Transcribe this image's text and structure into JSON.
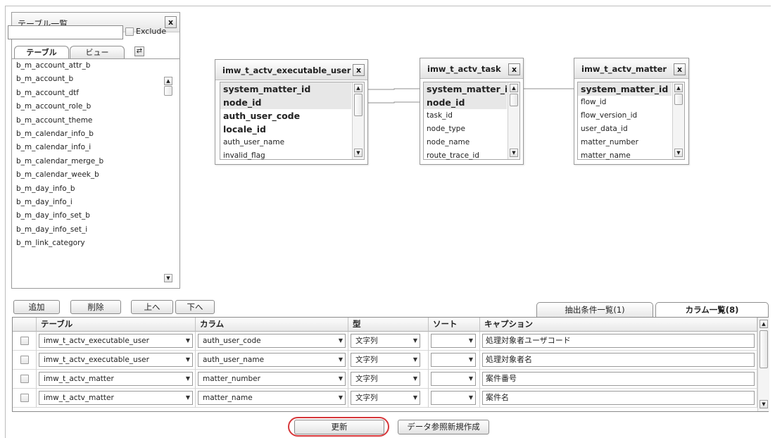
{
  "table_panel": {
    "title": "テーブル一覧",
    "close_glyph": "x",
    "search_placeholder": "",
    "exclude_label": "Exclude",
    "tabs": [
      "テーブル",
      "ビュー"
    ],
    "refresh_glyph": "⇄",
    "tables": [
      "b_m_account_attr_b",
      "b_m_account_b",
      "b_m_account_dtf",
      "b_m_account_role_b",
      "b_m_account_theme",
      "b_m_calendar_info_b",
      "b_m_calendar_info_i",
      "b_m_calendar_merge_b",
      "b_m_calendar_week_b",
      "b_m_day_info_b",
      "b_m_day_info_i",
      "b_m_day_info_set_b",
      "b_m_day_info_set_i",
      "b_m_link_category"
    ]
  },
  "entities": [
    {
      "name": "imw_t_actv_executable_user",
      "columns": [
        "system_matter_id",
        "node_id",
        "auth_user_code",
        "locale_id",
        "auth_user_name",
        "invalid_flag"
      ]
    },
    {
      "name": "imw_t_actv_task",
      "columns": [
        "system_matter_id",
        "node_id",
        "task_id",
        "node_type",
        "node_name",
        "route_trace_id"
      ]
    },
    {
      "name": "imw_t_actv_matter",
      "columns": [
        "system_matter_id",
        "flow_id",
        "flow_version_id",
        "user_data_id",
        "matter_number",
        "matter_name"
      ]
    }
  ],
  "toolbar": {
    "add": "追加",
    "delete": "削除",
    "up": "上へ",
    "down": "下へ"
  },
  "bottom_tabs": {
    "conditions": "抽出条件一覧(1)",
    "columns": "カラム一覧(8)"
  },
  "grid": {
    "headers": [
      "テーブル",
      "カラム",
      "型",
      "ソート",
      "キャプション"
    ],
    "rows": [
      {
        "table": "imw_t_actv_executable_user",
        "column": "auth_user_code",
        "type": "文字列",
        "sort": "",
        "caption": "処理対象者ユーザコード"
      },
      {
        "table": "imw_t_actv_executable_user",
        "column": "auth_user_name",
        "type": "文字列",
        "sort": "",
        "caption": "処理対象者名"
      },
      {
        "table": "imw_t_actv_matter",
        "column": "matter_number",
        "type": "文字列",
        "sort": "",
        "caption": "案件番号"
      },
      {
        "table": "imw_t_actv_matter",
        "column": "matter_name",
        "type": "文字列",
        "sort": "",
        "caption": "案件名"
      }
    ]
  },
  "actions": {
    "update": "更新",
    "new_data_reference": "データ参照新規作成"
  },
  "colors": {
    "highlight_ring": "#d6373a",
    "border": "#9a9a9a"
  }
}
